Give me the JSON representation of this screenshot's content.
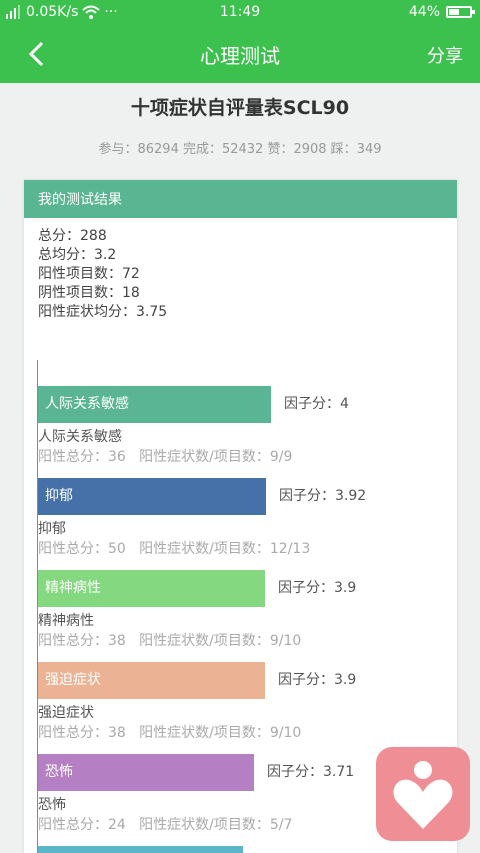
{
  "status_bar": {
    "network": "0.05K/s",
    "time": "11:49",
    "battery": "44%",
    "battery_level": 0.44
  },
  "nav": {
    "title": "心理测试",
    "share_label": "分享",
    "back_icon": "chevron-left-icon"
  },
  "header": {
    "heading": "十项症状自评量表SCL90",
    "stats": "参与：86294 完成：52432 赞：2908 踩：349"
  },
  "card": {
    "title": "我的测试结果",
    "summary": [
      "总分：288",
      "总均分：3.2",
      "阳性项目数：72",
      "阴性项目数：18",
      "阳性症状均分：3.75"
    ]
  },
  "chart_data": {
    "type": "bar",
    "orientation": "horizontal",
    "factor_prefix": "因子分：",
    "xlim": [
      0,
      4
    ],
    "bars": [
      {
        "label": "人际关系敏感",
        "value": 4,
        "color": "#5ab594",
        "meta": "阳性总分：36   阳性症状数/项目数：9/9"
      },
      {
        "label": "抑郁",
        "value": 3.92,
        "color": "#4671a8",
        "meta": "阳性总分：50   阳性症状数/项目数：12/13"
      },
      {
        "label": "精神病性",
        "value": 3.9,
        "color": "#84d87f",
        "meta": "阳性总分：38   阳性症状数/项目数：9/10"
      },
      {
        "label": "强迫症状",
        "value": 3.9,
        "color": "#ebb294",
        "meta": "阳性总分：38   阳性症状数/项目数：9/10"
      },
      {
        "label": "恐怖",
        "value": 3.71,
        "color": "#b57fc3",
        "meta": "阳性总分：24   阳性症状数/项目数：5/7"
      }
    ],
    "next_bar_color": "#5cb6c9"
  },
  "floating_button": {
    "icon": "heart-person-icon",
    "color": "#ef8f95"
  }
}
